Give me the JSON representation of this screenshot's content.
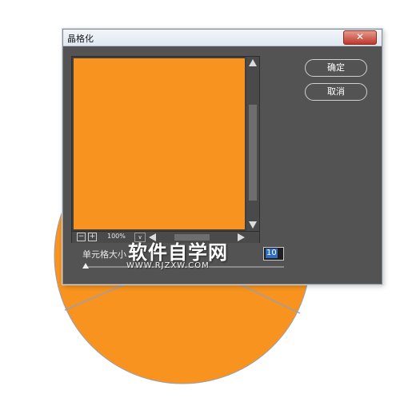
{
  "window": {
    "title": "晶格化",
    "close_icon": "close-icon"
  },
  "preview": {
    "fill_color": "#f7931e",
    "zoom_value": "100%",
    "zoom_minus": "−",
    "zoom_plus": "+",
    "zoom_dropdown": "∨"
  },
  "buttons": {
    "ok": "确定",
    "cancel": "取消"
  },
  "params": {
    "cell_size_label": "单元格大小",
    "cell_size_value": "10",
    "cell_size_slider_fraction": 0.0
  },
  "watermark": {
    "main": "软件自学网",
    "sub": "WWW.RJZXW.COM"
  },
  "background": {
    "shape_color": "#f7931e",
    "line_color": "#9aa0b0"
  }
}
